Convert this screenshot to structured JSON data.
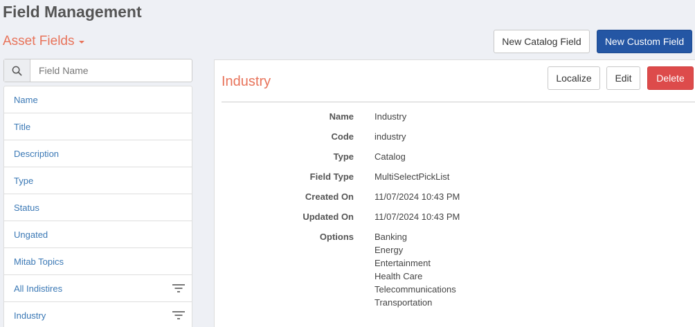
{
  "header": {
    "title": "Field Management",
    "section_dropdown": "Asset Fields",
    "new_catalog_field_label": "New Catalog Field",
    "new_custom_field_label": "New Custom Field"
  },
  "search": {
    "placeholder": "Field Name",
    "value": ""
  },
  "sidebar": {
    "items": [
      {
        "label": "Name",
        "icon": null
      },
      {
        "label": "Title",
        "icon": null
      },
      {
        "label": "Description",
        "icon": null
      },
      {
        "label": "Type",
        "icon": null
      },
      {
        "label": "Status",
        "icon": null
      },
      {
        "label": "Ungated",
        "icon": null
      },
      {
        "label": "Mitab Topics",
        "icon": null
      },
      {
        "label": "All Indistires",
        "icon": "filter-icon"
      },
      {
        "label": "Industry",
        "icon": "filter-icon"
      }
    ]
  },
  "detail": {
    "title": "Industry",
    "localize_label": "Localize",
    "edit_label": "Edit",
    "delete_label": "Delete",
    "fields": [
      {
        "key": "Name",
        "value": "Industry"
      },
      {
        "key": "Code",
        "value": "industry"
      },
      {
        "key": "Type",
        "value": "Catalog"
      },
      {
        "key": "Field Type",
        "value": "MultiSelectPickList"
      },
      {
        "key": "Created On",
        "value": "11/07/2024 10:43 PM"
      },
      {
        "key": "Updated On",
        "value": "11/07/2024 10:43 PM"
      }
    ],
    "options_label": "Options",
    "options": [
      "Banking",
      "Energy",
      "Entertainment",
      "Health Care",
      "Telecommunications",
      "Transportation"
    ]
  },
  "colors": {
    "accent": "#e8735a",
    "link": "#3a78b5",
    "primary": "#2456a4",
    "danger": "#dd4b4b",
    "background": "#eef0f5"
  }
}
